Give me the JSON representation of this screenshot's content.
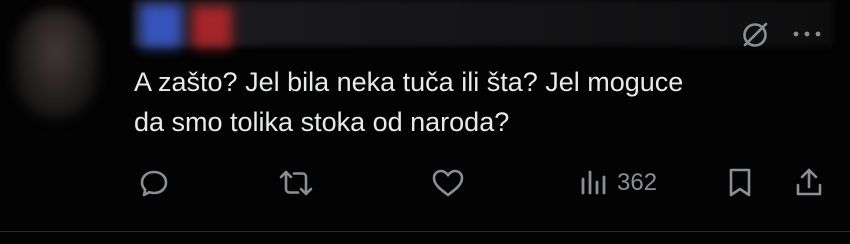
{
  "post": {
    "text_line1": "A zašto? Jel bila neka tuča ili šta? Jel moguce",
    "text_line2": "da smo tolika stoka od naroda?",
    "view_count": "362"
  },
  "icons": {
    "reply": "reply-icon",
    "repost": "repost-icon",
    "like": "like-icon",
    "views": "views-icon",
    "bookmark": "bookmark-icon",
    "share": "share-icon",
    "grok": "grok-icon",
    "more": "more-icon"
  },
  "colors": {
    "background": "#000000",
    "text": "#e7e9ea",
    "icon": "#8b8f94"
  }
}
